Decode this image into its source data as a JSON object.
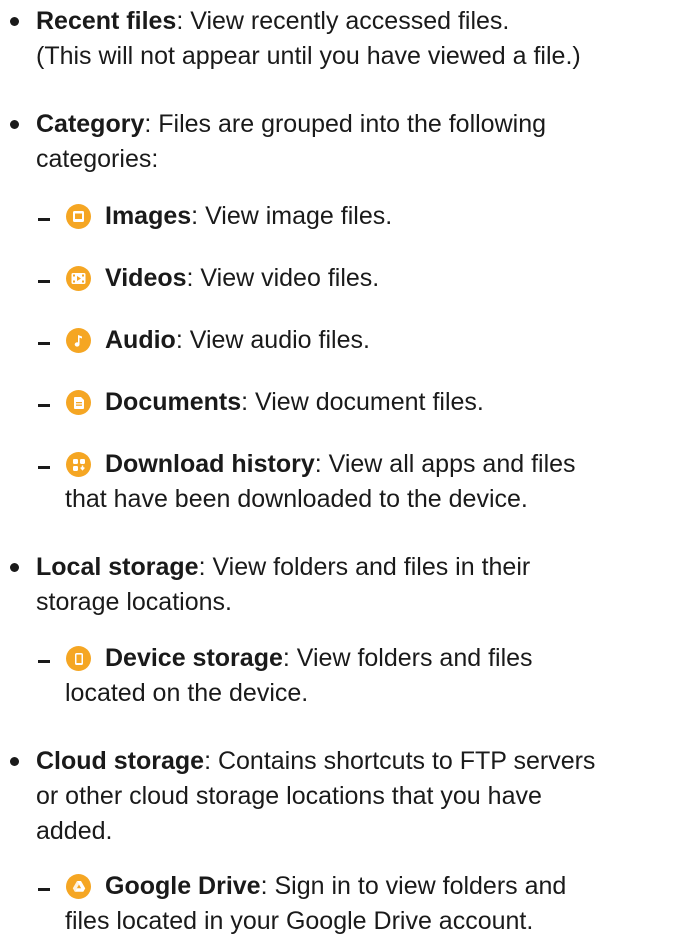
{
  "colors": {
    "icon_orange": "#F5A623",
    "text": "#1a1a1a"
  },
  "recent_files": {
    "term": "Recent files",
    "desc": ": View recently accessed files.",
    "desc2": "(This will not appear until you have viewed a file.)"
  },
  "category": {
    "term": "Category",
    "desc": ": Files are grouped into the following",
    "desc2": "categories:",
    "items": [
      {
        "icon": "image-icon",
        "term": "Images",
        "desc": ": View image files."
      },
      {
        "icon": "video-icon",
        "term": "Videos",
        "desc": ": View video files."
      },
      {
        "icon": "music-note-icon",
        "term": "Audio",
        "desc": ": View audio files."
      },
      {
        "icon": "document-icon",
        "term": "Documents",
        "desc": ": View document files."
      },
      {
        "icon": "download-icon",
        "term": "Download history",
        "desc": ": View all apps and files",
        "desc2": "that have been downloaded to the device."
      }
    ]
  },
  "local_storage": {
    "term": "Local storage",
    "desc": ": View folders and files in their",
    "desc2": "storage locations.",
    "items": [
      {
        "icon": "phone-icon",
        "term": "Device storage",
        "desc": ": View folders and files",
        "desc2": "located on the device."
      }
    ]
  },
  "cloud_storage": {
    "term": "Cloud storage",
    "desc": ": Contains shortcuts to FTP servers",
    "desc2": "or other cloud storage locations that you have",
    "desc3": "added.",
    "items": [
      {
        "icon": "google-drive-icon",
        "term": "Google Drive",
        "desc": ": Sign in to view folders and",
        "desc2": "files located in your Google Drive account."
      }
    ]
  }
}
